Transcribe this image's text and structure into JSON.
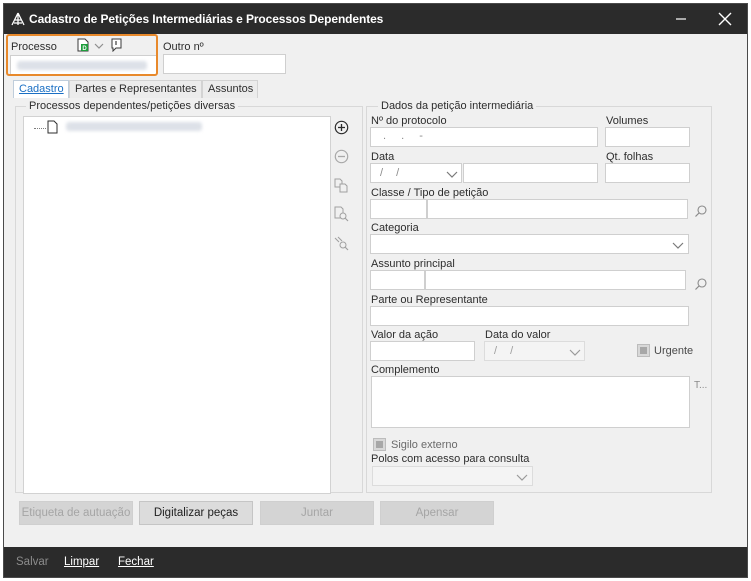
{
  "window": {
    "title": "Cadastro de Petições Intermediárias e Processos Dependentes",
    "minimize_icon": "minimize-icon",
    "close_icon": "close-icon"
  },
  "header": {
    "processo_label": "Processo",
    "outro_label": "Outro nº",
    "processo_value": "",
    "outro_value": ""
  },
  "tabs": [
    {
      "label": "Cadastro",
      "active": true
    },
    {
      "label": "Partes e Representantes",
      "active": false
    },
    {
      "label": "Assuntos",
      "active": false
    }
  ],
  "left_panel": {
    "title": "Processos dependentes/petições diversas"
  },
  "right_panel": {
    "title": "Dados da petição intermediária",
    "protocolo_label": "Nº do protocolo",
    "protocolo_value": ". . -",
    "volumes_label": "Volumes",
    "data_label": "Data",
    "data_value": "/ /",
    "qt_folhas_label": "Qt. folhas",
    "classe_label": "Classe / Tipo de petição",
    "categoria_label": "Categoria",
    "assunto_label": "Assunto principal",
    "parte_label": "Parte ou Representante",
    "valor_acao_label": "Valor da ação",
    "data_valor_label": "Data do valor",
    "data_valor_value": "/ /",
    "urgente_label": "Urgente",
    "complemento_label": "Complemento",
    "complemento_side": "T...",
    "sigilo_label": "Sigilo externo",
    "polos_label": "Polos com acesso para consulta"
  },
  "buttons": {
    "etiqueta": "Etiqueta de autuação",
    "digitalizar": "Digitalizar peças",
    "juntar": "Juntar",
    "apensar": "Apensar"
  },
  "bottom": {
    "salvar": "Salvar",
    "limpar": "Limpar",
    "fechar": "Fechar"
  },
  "colors": {
    "titlebar": "#2b2b2b",
    "highlight": "#e8892b",
    "accent": "#1a6fc4"
  }
}
